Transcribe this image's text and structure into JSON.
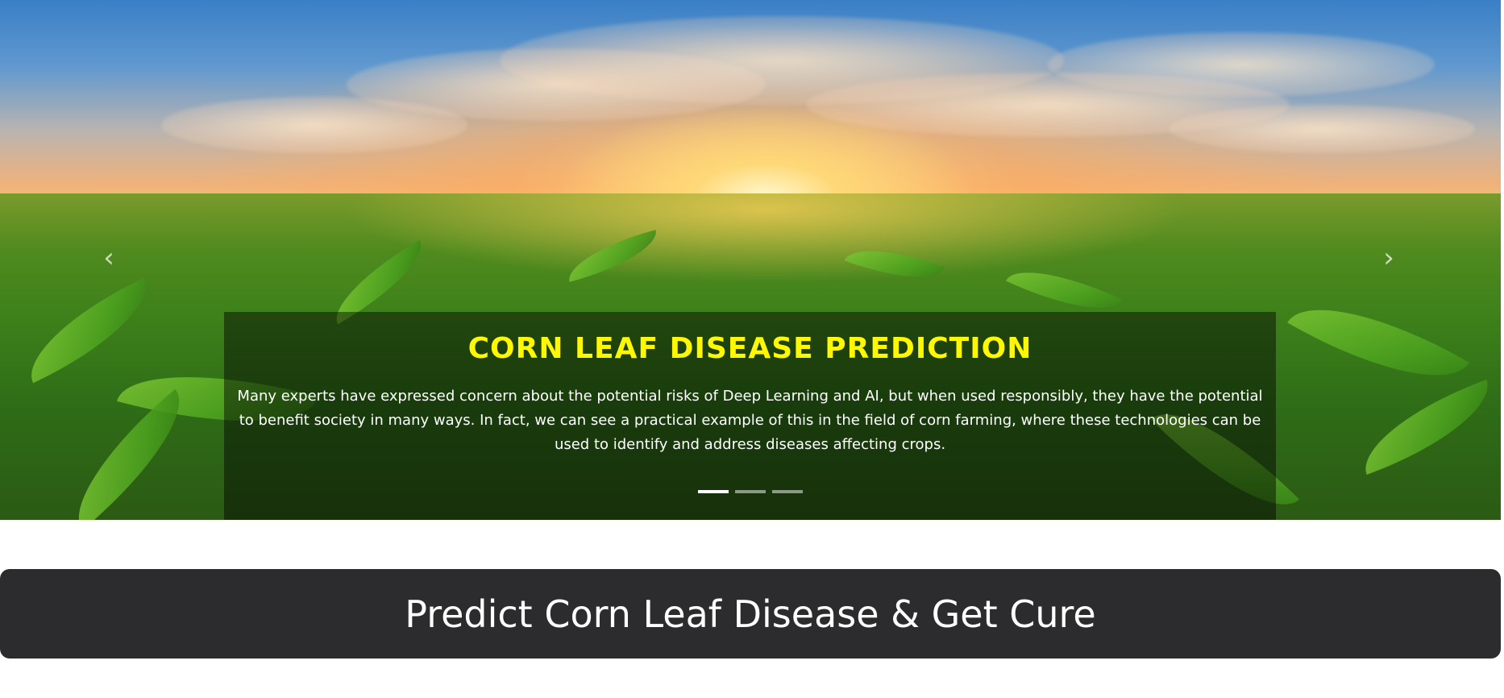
{
  "hero": {
    "title": "CORN LEAF DISEASE PREDICTION",
    "description": "Many experts have expressed concern about the potential risks of Deep Learning and AI, but when used responsibly, they have the potential to benefit society in many ways. In fact, we can see a practical example of this in the field of corn farming, where these technologies can be used to identify and address diseases affecting crops.",
    "slides": {
      "active_index": 0,
      "count": 3
    },
    "colors": {
      "title": "#fff800",
      "caption_bg": "rgba(0,0,0,0.45)"
    },
    "icons": {
      "prev": "chevron-left-icon",
      "next": "chevron-right-icon"
    },
    "prev_glyph": "‹",
    "next_glyph": "›"
  },
  "banner": {
    "title": "Predict Corn Leaf Disease & Get Cure",
    "background": "#2c2c2e"
  }
}
